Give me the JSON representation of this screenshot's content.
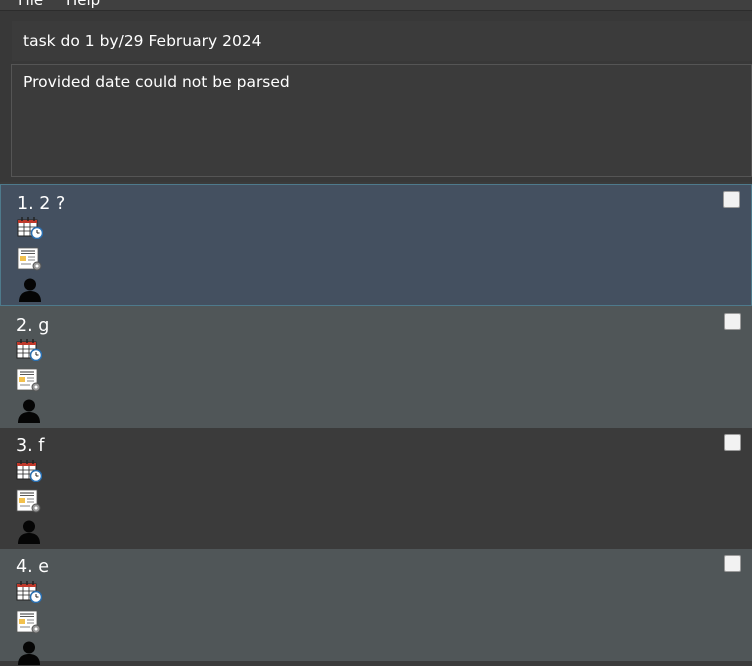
{
  "menu": {
    "file_label": "File",
    "help_label": "Help"
  },
  "command": {
    "value": "task do 1 by/29 February 2024"
  },
  "result": {
    "message": "Provided date could not be parsed"
  },
  "tasks": [
    {
      "title": "1. 2 ?",
      "checked": false
    },
    {
      "title": "2. g",
      "checked": false
    },
    {
      "title": "3. f",
      "checked": false
    },
    {
      "title": "4. e",
      "checked": false
    }
  ],
  "icons": [
    "calendar-clock-icon",
    "document-gear-icon",
    "person-icon"
  ]
}
